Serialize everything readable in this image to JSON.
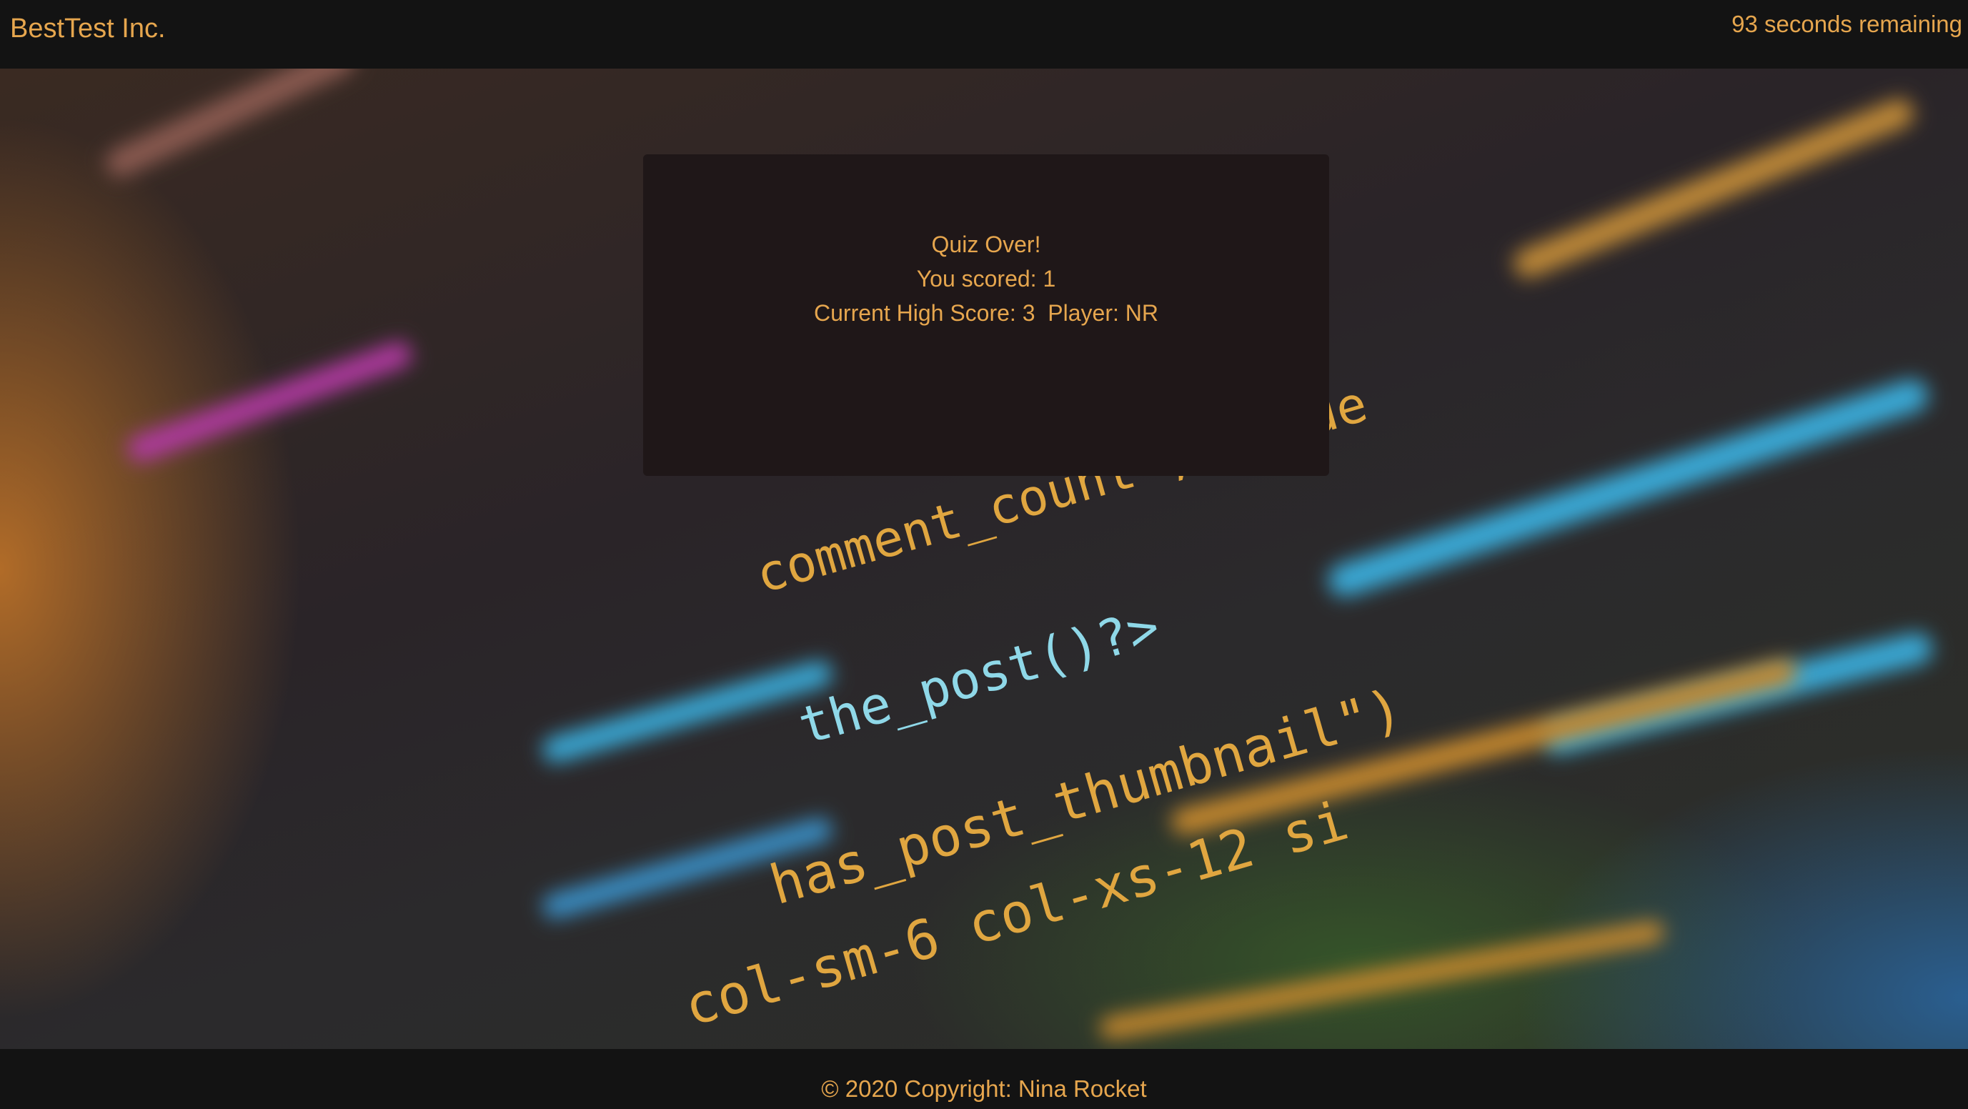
{
  "header": {
    "brand": "BestTest Inc.",
    "timer": "93 seconds remaining"
  },
  "quiz": {
    "title": "Quiz Over!",
    "score_line": "You scored: 1",
    "high_score_line": "Current High Score: 3  Player: NR"
  },
  "background": {
    "code_lines": [
      "comment_count', 'orde",
      "the_post()?>",
      "has_post_thumbnail\")",
      "col-sm-6 col-xs-12 si"
    ]
  },
  "footer": {
    "copyright": "© 2020 Copyright: Nina Rocket"
  },
  "colors": {
    "accent": "#e6a64e",
    "bar": "#131313",
    "card": "#1f1718"
  }
}
